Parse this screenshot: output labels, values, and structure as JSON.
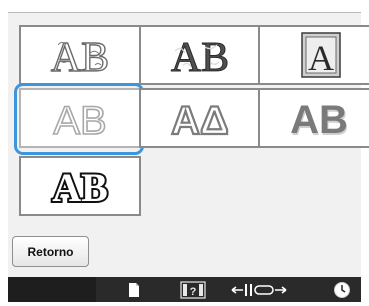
{
  "font_styles": [
    {
      "name": "floral-outline-ab",
      "text": "AB"
    },
    {
      "name": "ornate-floral-ab",
      "text": "AB"
    },
    {
      "name": "decorative-initial-a",
      "text": "A"
    },
    {
      "name": "outline-ab",
      "text": "AB",
      "selected": true
    },
    {
      "name": "outline-a-delta",
      "text": "AΔ"
    },
    {
      "name": "block-shadow-ab",
      "text": "AB"
    },
    {
      "name": "gothic-ab",
      "text": "AB"
    }
  ],
  "buttons": {
    "back_label": "Retorno"
  },
  "toolbar": {
    "icons": [
      "document-icon",
      "thread-color-icon",
      "width-adjust-icon",
      "clock-icon"
    ]
  },
  "colors": {
    "selection": "#3f95dc",
    "bar": "#1e1e1e"
  }
}
